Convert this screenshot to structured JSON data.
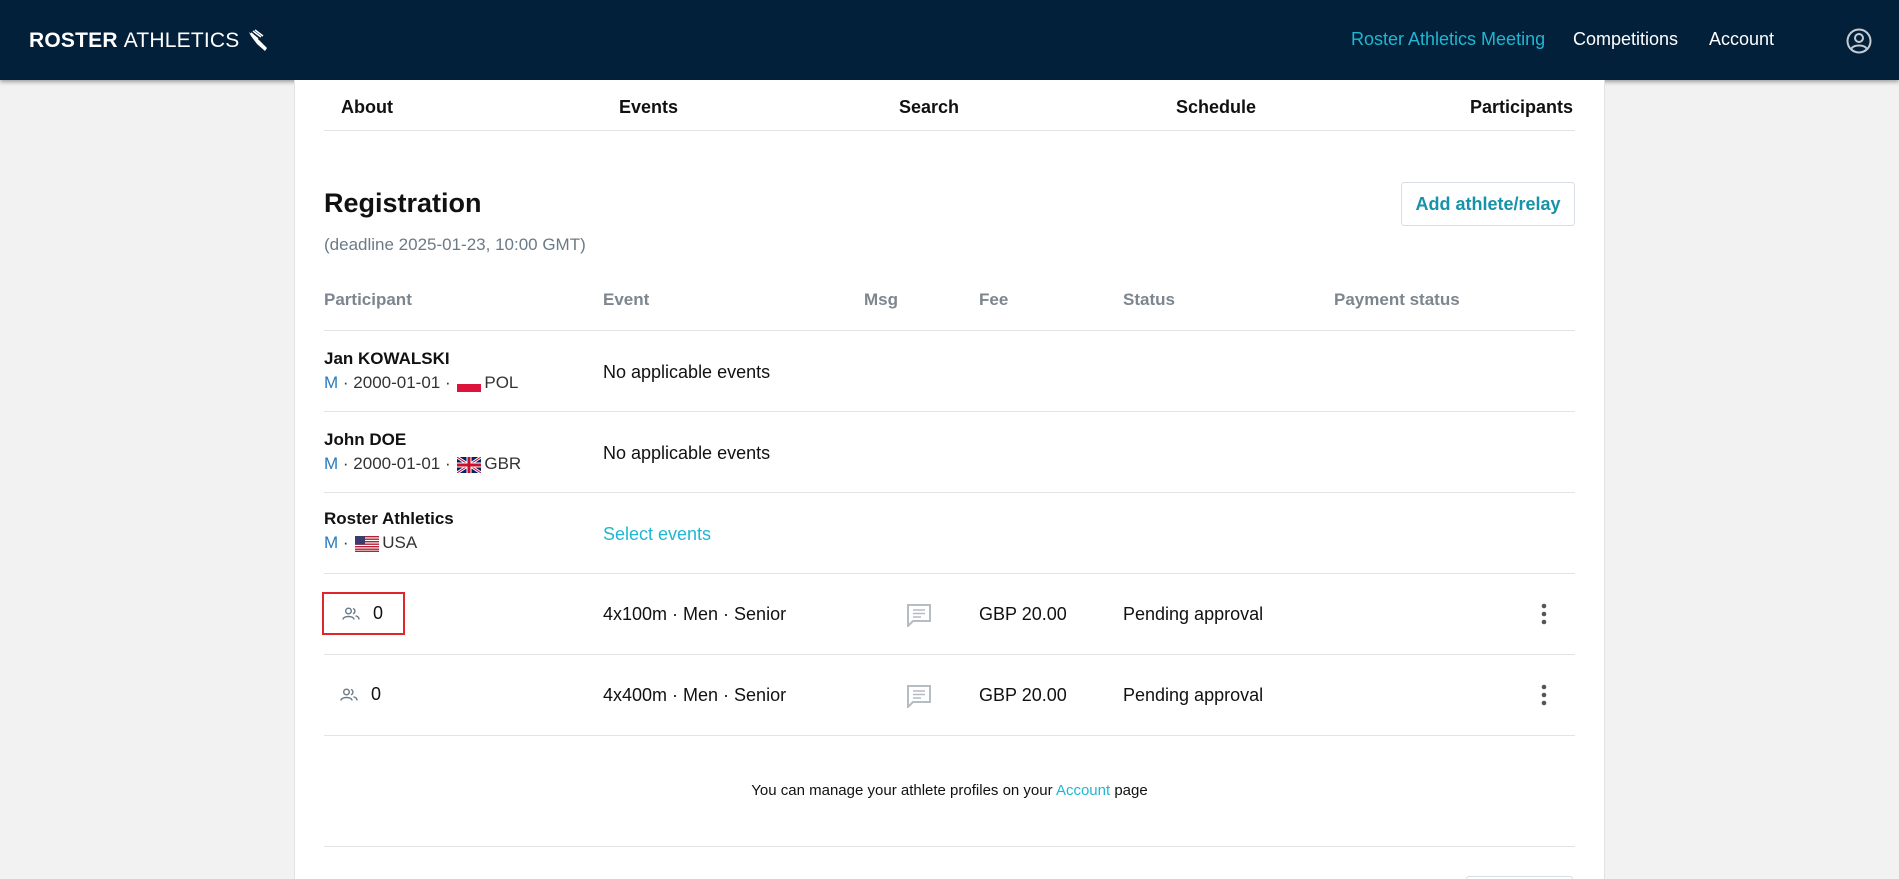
{
  "header": {
    "logo_bold": "ROSTER",
    "logo_light": "ATHLETICS",
    "nav": {
      "meeting": "Roster Athletics Meeting",
      "competitions": "Competitions",
      "account": "Account"
    },
    "accent_color": "#1fb7d1",
    "bg_color": "#02203a"
  },
  "tabs": [
    "About",
    "Events",
    "Search",
    "Schedule",
    "Participants"
  ],
  "registration": {
    "title": "Registration",
    "deadline": "(deadline 2025-01-23, 10:00 GMT)",
    "add_button": "Add athlete/relay"
  },
  "table": {
    "headers": {
      "participant": "Participant",
      "event": "Event",
      "msg": "Msg",
      "fee": "Fee",
      "status": "Status",
      "payment": "Payment status"
    },
    "athletes": [
      {
        "name": "Jan KOWALSKI",
        "sex": "M",
        "dob": "2000-01-01",
        "country": "POL",
        "flag": "flag-poland-icon",
        "event": "No applicable events"
      },
      {
        "name": "John DOE",
        "sex": "M",
        "dob": "2000-01-01",
        "country": "GBR",
        "flag": "flag-uk-icon",
        "event": "No applicable events"
      },
      {
        "name": "Roster Athletics",
        "sex": "M",
        "country": "USA",
        "flag": "flag-usa-icon",
        "event": "Select events"
      }
    ],
    "relays": [
      {
        "count": "0",
        "event": "4x100m · Men · Senior",
        "fee": "GBP 20.00",
        "status": "Pending approval",
        "highlighted": true
      },
      {
        "count": "0",
        "event": "4x400m · Men · Senior",
        "fee": "GBP 20.00",
        "status": "Pending approval",
        "highlighted": false
      }
    ]
  },
  "footer": {
    "before": "You can manage your athlete profiles on your ",
    "link": "Account",
    "after": " page"
  },
  "sep": " · "
}
